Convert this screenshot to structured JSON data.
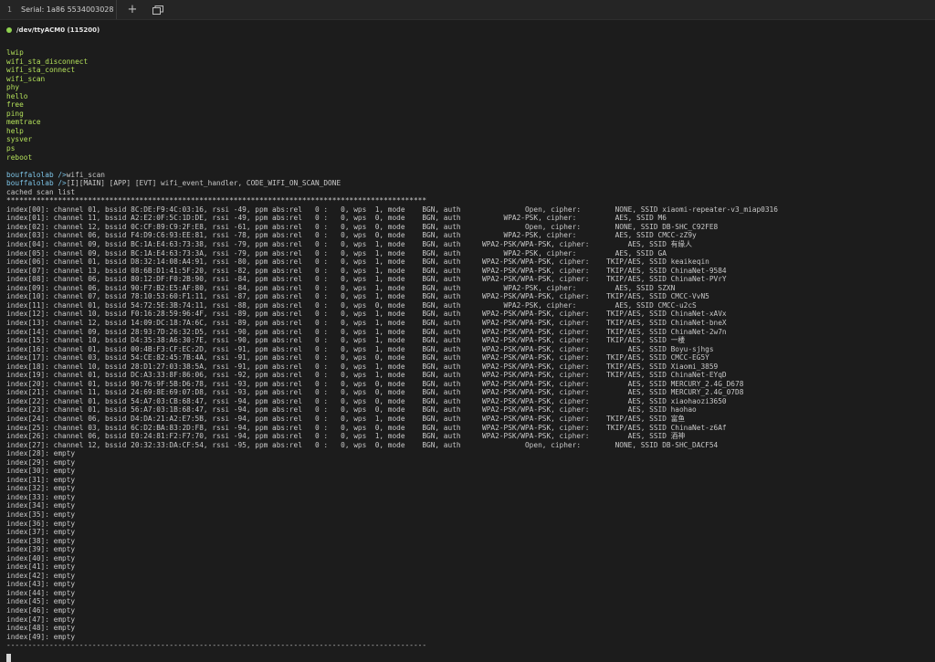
{
  "tab": {
    "index": "1",
    "title": "Serial: 1a86 5534003028"
  },
  "toolbar": {
    "new_tab_icon": "plus-icon",
    "window_icon": "windows-icon"
  },
  "device": {
    "label": "/dev/ttyACM0 (115200)",
    "status_color": "#8fd14f"
  },
  "terminal": {
    "commands": [
      "lwip",
      "wifi_sta_disconnect",
      "wifi_sta_connect",
      "wifi_scan",
      "phy",
      "hello",
      "free",
      "ping",
      "memtrace",
      "help",
      "sysver",
      "ps",
      "reboot"
    ],
    "prompt": "bouffalolab />",
    "input_line": "wifi_scan",
    "log_line": "[I][MAIN] [APP] [EVT] wifi_event_handler, CODE_WIFI_ON_SCAN_DONE",
    "cached_title": "cached scan list",
    "star_rule": "**************************************************************************************************",
    "scan_rows": [
      "index[00]: channel 01, bssid 8C:DE:F9:4C:03:16, rssi -49, ppm abs:rel   0 :   0, wps  1, mode    BGN, auth               Open, cipher:        NONE, SSID xiaomi-repeater-v3_miap0316",
      "index[01]: channel 11, bssid A2:E2:0F:5C:1D:DE, rssi -49, ppm abs:rel   0 :   0, wps  0, mode    BGN, auth          WPA2-PSK, cipher:         AES, SSID M6",
      "index[02]: channel 12, bssid 0C:CF:89:C9:2F:E8, rssi -61, ppm abs:rel   0 :   0, wps  0, mode    BGN, auth               Open, cipher:        NONE, SSID DB-SHC_C92FE8",
      "index[03]: channel 06, bssid F4:D9:C6:93:EE:81, rssi -78, ppm abs:rel   0 :   0, wps  0, mode    BGN, auth          WPA2-PSK, cipher:         AES, SSID CMCC-zZ9y",
      "index[04]: channel 09, bssid BC:1A:E4:63:73:38, rssi -79, ppm abs:rel   0 :   0, wps  1, mode    BGN, auth     WPA2-PSK/WPA-PSK, cipher:         AES, SSID 有缘人",
      "index[05]: channel 09, bssid BC:1A:E4:63:73:3A, rssi -79, ppm abs:rel   0 :   0, wps  1, mode    BGN, auth          WPA2-PSK, cipher:         AES, SSID GA",
      "index[06]: channel 01, bssid D8:32:14:08:A4:91, rssi -80, ppm abs:rel   0 :   0, wps  1, mode    BGN, auth     WPA2-PSK/WPA-PSK, cipher:    TKIP/AES, SSID keaikeqin",
      "index[07]: channel 13, bssid 08:6B:D1:41:5F:20, rssi -82, ppm abs:rel   0 :   0, wps  1, mode    BGN, auth     WPA2-PSK/WPA-PSK, cipher:    TKIP/AES, SSID ChinaNet-9584",
      "index[08]: channel 06, bssid 80:12:DF:F0:2B:90, rssi -84, ppm abs:rel   0 :   0, wps  1, mode    BGN, auth     WPA2-PSK/WPA-PSK, cipher:    TKIP/AES, SSID ChinaNet-PVrY",
      "index[09]: channel 06, bssid 90:F7:B2:E5:AF:80, rssi -84, ppm abs:rel   0 :   0, wps  1, mode    BGN, auth          WPA2-PSK, cipher:         AES, SSID SZXN",
      "index[10]: channel 07, bssid 78:10:53:60:F1:11, rssi -87, ppm abs:rel   0 :   0, wps  1, mode    BGN, auth     WPA2-PSK/WPA-PSK, cipher:    TKIP/AES, SSID CMCC-VvN5",
      "index[11]: channel 01, bssid 54:72:5E:3B:74:11, rssi -88, ppm abs:rel   0 :   0, wps  0, mode    BGN, auth          WPA2-PSK, cipher:         AES, SSID CMCC-u2cS",
      "index[12]: channel 10, bssid F0:16:28:59:96:4F, rssi -89, ppm abs:rel   0 :   0, wps  1, mode    BGN, auth     WPA2-PSK/WPA-PSK, cipher:    TKIP/AES, SSID ChinaNet-xAVx",
      "index[13]: channel 12, bssid 14:09:DC:18:7A:6C, rssi -89, ppm abs:rel   0 :   0, wps  1, mode    BGN, auth     WPA2-PSK/WPA-PSK, cipher:    TKIP/AES, SSID ChinaNet-bneX",
      "index[14]: channel 09, bssid 28:93:7D:26:32:D5, rssi -90, ppm abs:rel   0 :   0, wps  1, mode    BGN, auth     WPA2-PSK/WPA-PSK, cipher:    TKIP/AES, SSID ChinaNet-2w7n",
      "index[15]: channel 10, bssid D4:35:38:A6:30:7E, rssi -90, ppm abs:rel   0 :   0, wps  1, mode    BGN, auth     WPA2-PSK/WPA-PSK, cipher:    TKIP/AES, SSID 一楼",
      "index[16]: channel 01, bssid 00:4B:F3:CF:EC:2D, rssi -91, ppm abs:rel   0 :   0, wps  1, mode    BGN, auth     WPA2-PSK/WPA-PSK, cipher:         AES, SSID Boyu-sjhgs",
      "index[17]: channel 03, bssid 54:CE:82:45:7B:4A, rssi -91, ppm abs:rel   0 :   0, wps  0, mode    BGN, auth     WPA2-PSK/WPA-PSK, cipher:    TKIP/AES, SSID CMCC-EG5Y",
      "index[18]: channel 10, bssid 28:D1:27:03:38:5A, rssi -91, ppm abs:rel   0 :   0, wps  1, mode    BGN, auth     WPA2-PSK/WPA-PSK, cipher:    TKIP/AES, SSID Xiaomi_3859",
      "index[19]: channel 01, bssid DC:A3:33:8F:86:06, rssi -92, ppm abs:rel   0 :   0, wps  1, mode    BGN, auth     WPA2-PSK/WPA-PSK, cipher:    TKIP/AES, SSID ChinaNet-EYqD",
      "index[20]: channel 01, bssid 90:76:9F:5B:D6:78, rssi -93, ppm abs:rel   0 :   0, wps  0, mode    BGN, auth     WPA2-PSK/WPA-PSK, cipher:         AES, SSID MERCURY_2.4G_D678",
      "index[21]: channel 11, bssid 24:69:8E:69:07:D8, rssi -93, ppm abs:rel   0 :   0, wps  0, mode    BGN, auth     WPA2-PSK/WPA-PSK, cipher:         AES, SSID MERCURY_2.4G_07D8",
      "index[22]: channel 01, bssid 54:A7:03:CB:68:47, rssi -94, ppm abs:rel   0 :   0, wps  0, mode    BGN, auth     WPA2-PSK/WPA-PSK, cipher:         AES, SSID xiaohaozi3650",
      "index[23]: channel 01, bssid 56:A7:03:1B:68:47, rssi -94, ppm abs:rel   0 :   0, wps  0, mode    BGN, auth     WPA2-PSK/WPA-PSK, cipher:         AES, SSID haohao",
      "index[24]: channel 06, bssid D4:DA:21:A2:E7:5B, rssi -94, ppm abs:rel   0 :   0, wps  1, mode    BGN, auth     WPA2-PSK/WPA-PSK, cipher:    TKIP/AES, SSID 富鱼",
      "index[25]: channel 03, bssid 6C:D2:BA:83:2D:F8, rssi -94, ppm abs:rel   0 :   0, wps  0, mode    BGN, auth     WPA2-PSK/WPA-PSK, cipher:    TKIP/AES, SSID ChinaNet-z6Af",
      "index[26]: channel 06, bssid E0:24:81:F2:F7:70, rssi -94, ppm abs:rel   0 :   0, wps  1, mode    BGN, auth     WPA2-PSK/WPA-PSK, cipher:         AES, SSID 酒神",
      "index[27]: channel 12, bssid 20:32:33:DA:CF:54, rssi -95, ppm abs:rel   0 :   0, wps  0, mode    BGN, auth               Open, cipher:        NONE, SSID DB-SHC_DACF54",
      "index[28]: empty",
      "index[29]: empty",
      "index[30]: empty",
      "index[31]: empty",
      "index[32]: empty",
      "index[33]: empty",
      "index[34]: empty",
      "index[35]: empty",
      "index[36]: empty",
      "index[37]: empty",
      "index[38]: empty",
      "index[39]: empty",
      "index[40]: empty",
      "index[41]: empty",
      "index[42]: empty",
      "index[43]: empty",
      "index[44]: empty",
      "index[45]: empty",
      "index[46]: empty",
      "index[47]: empty",
      "index[48]: empty",
      "index[49]: empty"
    ],
    "dash_rule": "--------------------------------------------------------------------------------------------------"
  }
}
